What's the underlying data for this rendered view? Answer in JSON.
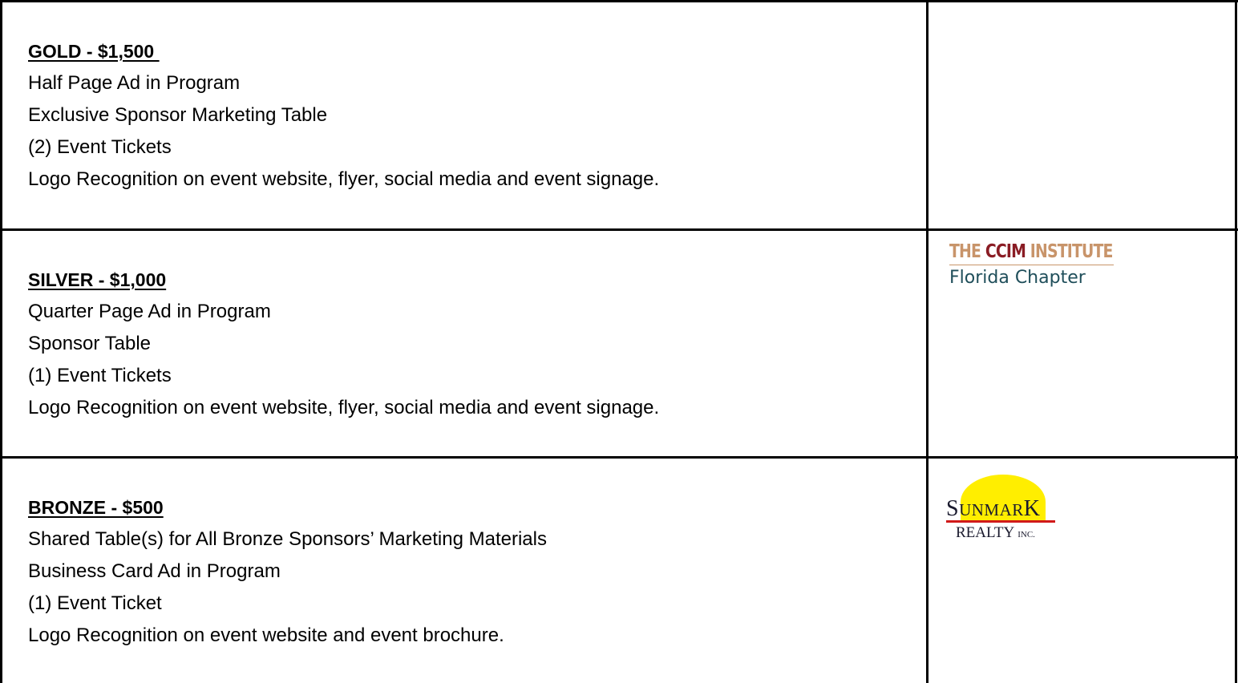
{
  "tiers": [
    {
      "title": "GOLD - $1,500 ",
      "benefits": [
        "Half Page Ad in Program",
        "Exclusive Sponsor Marketing Table",
        "(2) Event Tickets",
        "Logo Recognition on event website, flyer, social media and event signage."
      ]
    },
    {
      "title": "SILVER - $1,000",
      "benefits": [
        "Quarter Page Ad in Program",
        "Sponsor Table",
        "(1) Event Tickets",
        "Logo Recognition on event website, flyer, social media and event signage."
      ]
    },
    {
      "title": "BRONZE - $500",
      "benefits": [
        "Shared Table(s) for All Bronze Sponsors’ Marketing Materials",
        "Business Card Ad in Program",
        "(1) Event Ticket",
        "Logo Recognition on event website and event brochure."
      ]
    }
  ],
  "logos": {
    "ccim": {
      "word1": "THE",
      "word2": "CCIM",
      "word3": "INSTITUTE",
      "subtitle": "Florida Chapter",
      "colors": {
        "tan": "#c8946a",
        "maroon": "#8a1c24",
        "teal": "#1f4e5a"
      }
    },
    "sunmark": {
      "s_big": "S",
      "word_small": "UNMAR",
      "k_big": "K",
      "realty": "REALTY",
      "inc": "INC.",
      "colors": {
        "sun": "#ffee00",
        "rule": "#d11a1a",
        "text": "#1a1a2e"
      }
    }
  }
}
